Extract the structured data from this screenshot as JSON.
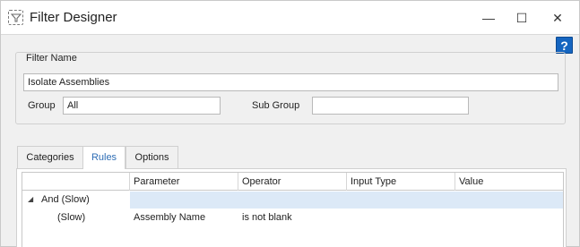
{
  "window": {
    "title": "Filter Designer",
    "controls": {
      "minimize": "—",
      "maximize": "☐",
      "close": "✕"
    }
  },
  "help": {
    "label": "?"
  },
  "filter_name": {
    "legend": "Filter Name",
    "name_value": "Isolate Assemblies",
    "group_label": "Group",
    "group_value": "All",
    "subgroup_label": "Sub Group",
    "subgroup_value": ""
  },
  "tabs": [
    {
      "label": "Categories",
      "selected": false
    },
    {
      "label": "Rules",
      "selected": true
    },
    {
      "label": "Options",
      "selected": false
    }
  ],
  "rules_grid": {
    "columns": [
      "",
      "Parameter",
      "Operator",
      "Input Type",
      "Value"
    ],
    "rows": [
      {
        "tree": "And (Slow)",
        "parameter": "",
        "operator": "",
        "input_type": "",
        "value": "",
        "expanded": true
      },
      {
        "tree": "(Slow)",
        "parameter": "Assembly Name",
        "operator": "is not blank",
        "input_type": "",
        "value": ""
      }
    ]
  },
  "colors": {
    "accent": "#2e6db5",
    "help_button": "#1565c0",
    "selection": "#dce9f7"
  }
}
